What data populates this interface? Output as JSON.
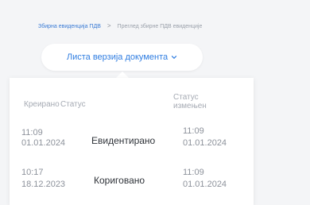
{
  "breadcrumb": {
    "link": "Збирна евиденција ПДВ",
    "separator": ">",
    "current": "Преглед збирне ПДВ евиденције"
  },
  "version_button": {
    "label": "Листа верзија документа",
    "icon": "chevron-down-icon"
  },
  "versions_table": {
    "columns": {
      "created": "Креирано",
      "status": "Статус",
      "status_changed": "Статус измењен"
    },
    "rows": [
      {
        "created_time": "11:09",
        "created_date": "01.01.2024",
        "status": "Евидентирано",
        "changed_time": "11:09",
        "changed_date": "01.01.2024"
      },
      {
        "created_time": "10:17",
        "created_date": "18.12.2023",
        "status": "Кориговано",
        "changed_time": "11:09",
        "changed_date": "01.01.2024"
      }
    ]
  },
  "colors": {
    "accent": "#2f7de1",
    "background": "#f4f5f7"
  }
}
